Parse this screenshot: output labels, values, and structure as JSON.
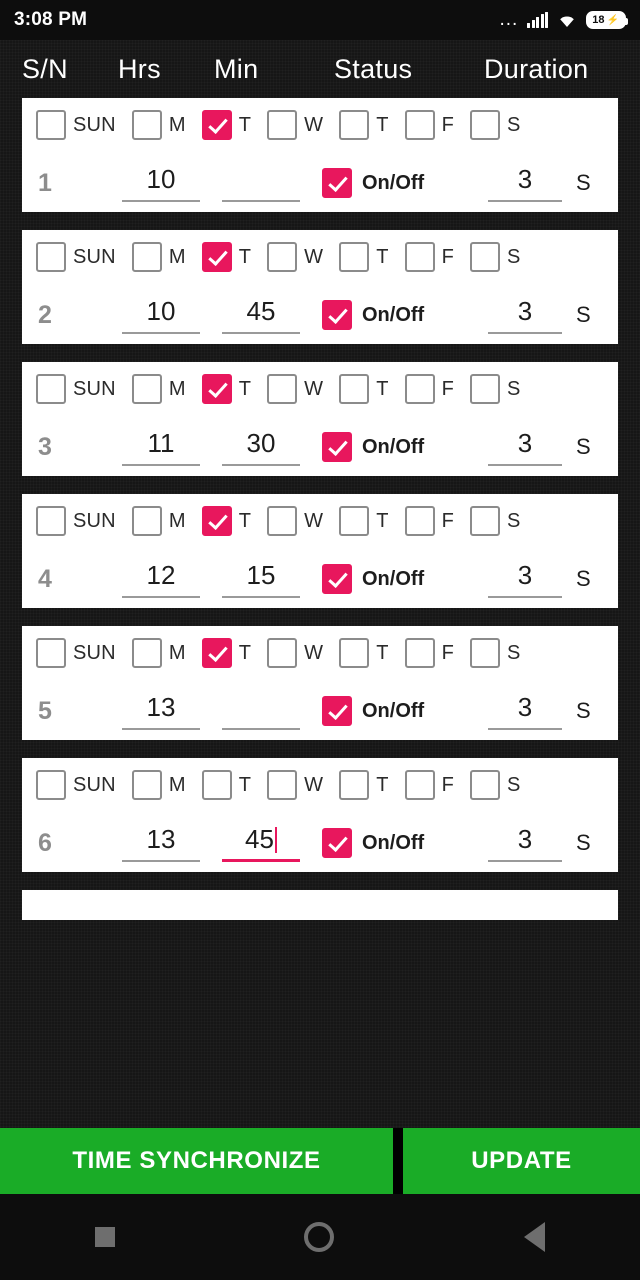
{
  "status_bar": {
    "clock": "3:08 PM",
    "overflow_dots": "...",
    "battery_level": "18"
  },
  "header": {
    "sn": "S/N",
    "hrs": "Hrs",
    "min": "Min",
    "status": "Status",
    "duration": "Duration"
  },
  "day_labels": [
    "SUN",
    "M",
    "T",
    "W",
    "T",
    "F",
    "S"
  ],
  "colors": {
    "accent": "#e8175d",
    "action": "#1aac27",
    "card": "#ffffff"
  },
  "rows": [
    {
      "sn": "1",
      "days": [
        false,
        false,
        true,
        false,
        false,
        false,
        false
      ],
      "hrs": "10",
      "min": "",
      "status_on": true,
      "status_label": "On/Off",
      "duration": "3",
      "duration_suffix": "S",
      "min_focused": false
    },
    {
      "sn": "2",
      "days": [
        false,
        false,
        true,
        false,
        false,
        false,
        false
      ],
      "hrs": "10",
      "min": "45",
      "status_on": true,
      "status_label": "On/Off",
      "duration": "3",
      "duration_suffix": "S",
      "min_focused": false
    },
    {
      "sn": "3",
      "days": [
        false,
        false,
        true,
        false,
        false,
        false,
        false
      ],
      "hrs": "11",
      "min": "30",
      "status_on": true,
      "status_label": "On/Off",
      "duration": "3",
      "duration_suffix": "S",
      "min_focused": false
    },
    {
      "sn": "4",
      "days": [
        false,
        false,
        true,
        false,
        false,
        false,
        false
      ],
      "hrs": "12",
      "min": "15",
      "status_on": true,
      "status_label": "On/Off",
      "duration": "3",
      "duration_suffix": "S",
      "min_focused": false
    },
    {
      "sn": "5",
      "days": [
        false,
        false,
        true,
        false,
        false,
        false,
        false
      ],
      "hrs": "13",
      "min": "",
      "status_on": true,
      "status_label": "On/Off",
      "duration": "3",
      "duration_suffix": "S",
      "min_focused": false
    },
    {
      "sn": "6",
      "days": [
        false,
        false,
        false,
        false,
        false,
        false,
        false
      ],
      "hrs": "13",
      "min": "45",
      "status_on": true,
      "status_label": "On/Off",
      "duration": "3",
      "duration_suffix": "S",
      "min_focused": true
    }
  ],
  "actions": {
    "time_synchronize": "TIME SYNCHRONIZE",
    "update": "UPDATE"
  },
  "nav": {
    "recents": "recents-square-icon",
    "home": "home-circle-icon",
    "back": "back-triangle-icon"
  }
}
